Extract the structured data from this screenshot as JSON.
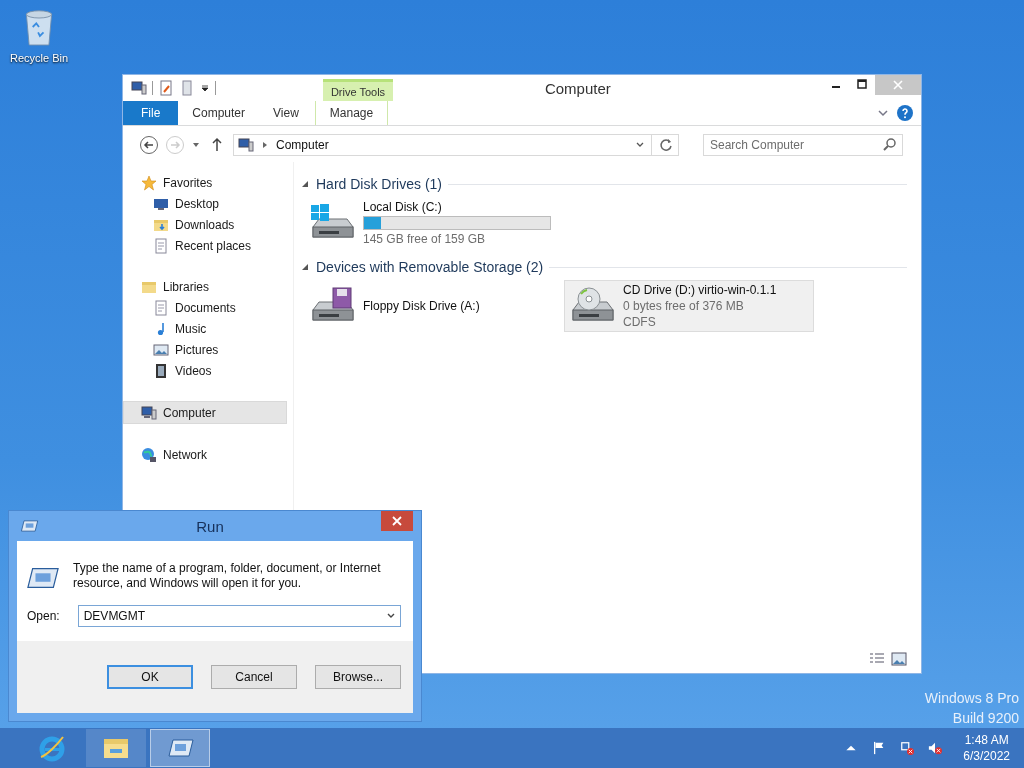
{
  "desktop": {
    "icons": [
      {
        "kind": "recycle-bin",
        "label": "Recycle Bin"
      }
    ],
    "edition_lines": [
      "Windows 8 Pro",
      "Build 9200"
    ]
  },
  "explorer": {
    "title": "Computer",
    "tool_group": "Drive Tools",
    "ribbon_tabs": [
      {
        "kind": "file",
        "label": "File"
      },
      {
        "kind": "tab",
        "label": "Computer"
      },
      {
        "kind": "tab",
        "label": "View"
      },
      {
        "kind": "contextual",
        "label": "Manage"
      }
    ],
    "address": "Computer",
    "search": {
      "placeholder": "Search Computer"
    },
    "nav": [
      {
        "kind": "star",
        "label": "Favorites",
        "selected": false,
        "children": [
          {
            "kind": "desktop",
            "label": "Desktop",
            "selected": false
          },
          {
            "kind": "downloads",
            "label": "Downloads",
            "selected": false
          },
          {
            "kind": "recent",
            "label": "Recent places",
            "selected": false
          }
        ]
      },
      {
        "kind": "libraries",
        "label": "Libraries",
        "selected": false,
        "children": [
          {
            "kind": "documents",
            "label": "Documents",
            "selected": false
          },
          {
            "kind": "music",
            "label": "Music",
            "selected": false
          },
          {
            "kind": "pictures",
            "label": "Pictures",
            "selected": false
          },
          {
            "kind": "videos",
            "label": "Videos",
            "selected": false
          }
        ]
      },
      {
        "kind": "computer",
        "label": "Computer",
        "selected": true
      },
      {
        "kind": "network",
        "label": "Network",
        "selected": false
      }
    ],
    "groups": [
      {
        "title": "Hard Disk Drives (1)",
        "expanded": true,
        "items": [
          {
            "kind": "hdd",
            "name": "Local Disk (C:)",
            "level": 0.09,
            "lines": [
              "145 GB free of 159 GB"
            ],
            "selected": false
          }
        ]
      },
      {
        "title": "Devices with Removable Storage (2)",
        "expanded": true,
        "items": [
          {
            "kind": "floppy",
            "name": "Floppy Disk Drive (A:)",
            "selected": false
          },
          {
            "kind": "cd",
            "name": "CD Drive (D:) virtio-win-0.1.1",
            "lines": [
              "0 bytes free of 376 MB",
              "CDFS"
            ],
            "selected": true
          }
        ]
      }
    ]
  },
  "run_dialog": {
    "title": "Run",
    "message": "Type the name of a program, folder, document, or Internet resource, and Windows will open it for you.",
    "open_label": "Open:",
    "value": "DEVMGMT",
    "buttons": [
      {
        "label": "OK",
        "default": true
      },
      {
        "label": "Cancel",
        "default": false
      },
      {
        "label": "Browse...",
        "default": false
      }
    ]
  },
  "taskbar": {
    "apps": [
      {
        "kind": "ie",
        "selected": false
      },
      {
        "kind": "explorer",
        "selected": false
      },
      {
        "kind": "run",
        "selected": true
      }
    ],
    "time": "1:48 AM",
    "date": "6/3/2022"
  }
}
